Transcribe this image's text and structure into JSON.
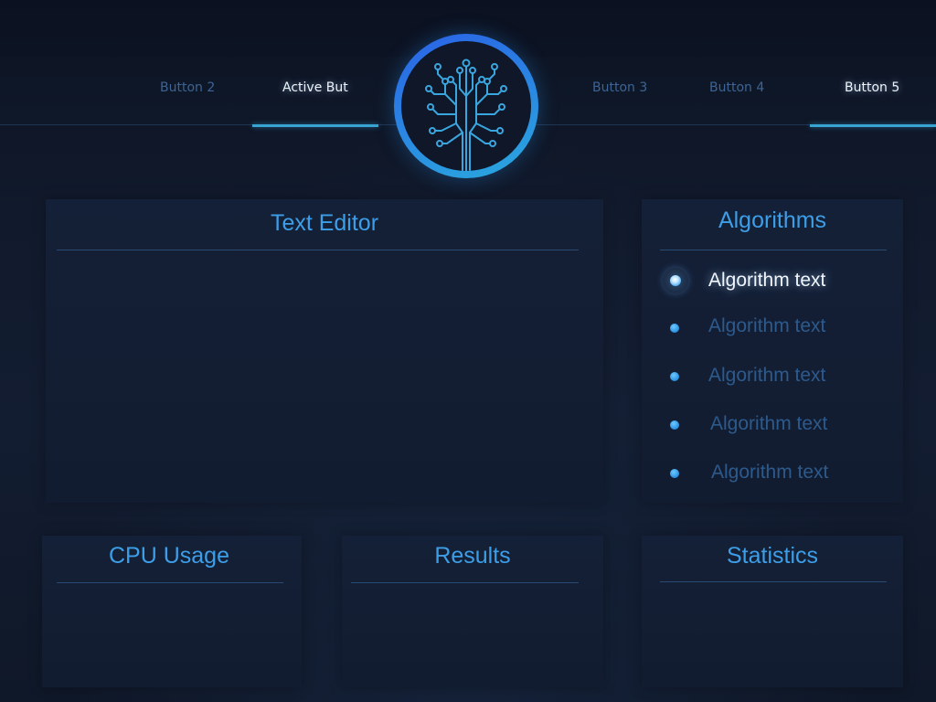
{
  "nav": {
    "items": [
      {
        "label": "Button 2",
        "active": false
      },
      {
        "label": "Active But",
        "active": true
      },
      {
        "label": "Button 3",
        "active": false
      },
      {
        "label": "Button 4",
        "active": false
      },
      {
        "label": "Button 5",
        "active": true
      }
    ]
  },
  "logo": {
    "icon": "circuit-tree-icon"
  },
  "editor": {
    "title": "Text Editor"
  },
  "algorithms": {
    "title": "Algorithms",
    "selected_index": 0,
    "items": [
      {
        "label": "Algorithm text"
      },
      {
        "label": "Algorithm text"
      },
      {
        "label": "Algorithm text"
      },
      {
        "label": "Algorithm text"
      },
      {
        "label": "Algorithm text"
      }
    ]
  },
  "cpu": {
    "title": "CPU Usage"
  },
  "results": {
    "title": "Results"
  },
  "statistics": {
    "title": "Statistics"
  },
  "colors": {
    "accent": "#3d9ee8",
    "active_underline": "#38a4d2",
    "inactive_text": "#3d6494",
    "background": "#0f1727"
  }
}
